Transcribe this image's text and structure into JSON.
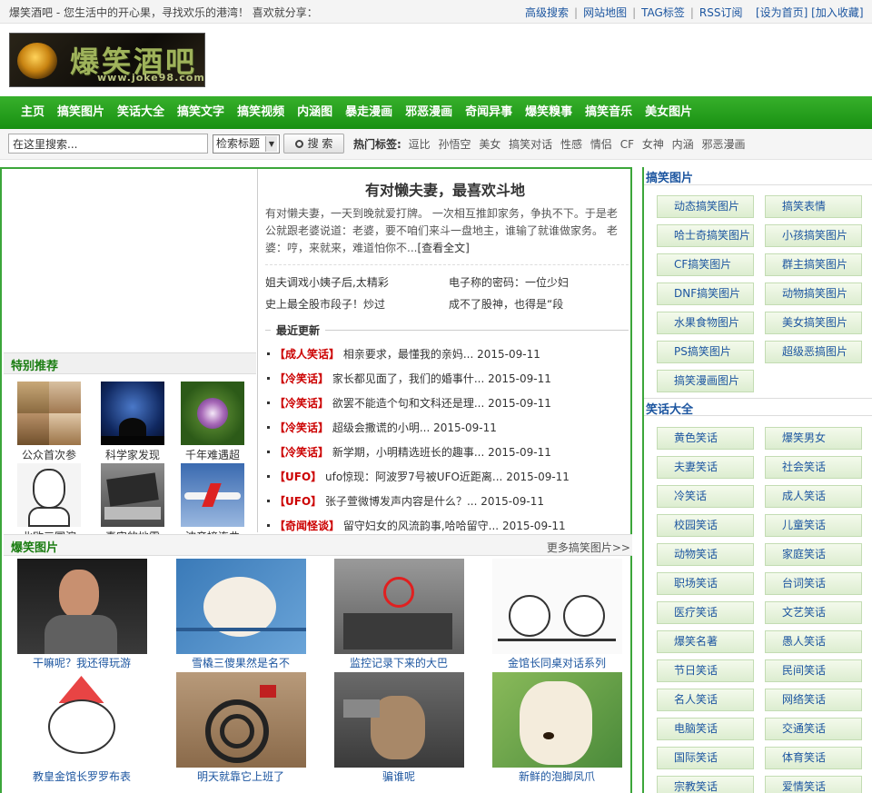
{
  "topbar": {
    "tagline": "爆笑酒吧 - 您生活中的开心果，寻找欢乐的港湾！   喜欢就分享：",
    "links": [
      "高级搜索",
      "网站地图",
      "TAG标签",
      "RSS订阅"
    ],
    "home_fav": "[设为首页] [加入收藏]"
  },
  "logo": {
    "big": "爆笑酒吧",
    "url": "www.joke98.com"
  },
  "nav": [
    "主页",
    "搞笑图片",
    "笑话大全",
    "搞笑文字",
    "搞笑视频",
    "内涵图",
    "暴走漫画",
    "邪恶漫画",
    "奇闻异事",
    "爆笑糗事",
    "搞笑音乐",
    "美女图片"
  ],
  "search": {
    "value": "在这里搜索...",
    "select_label": "检索标题",
    "button": "搜 索",
    "hot_label": "热门标签:",
    "hot_tags": [
      "逗比",
      "孙悟空",
      "美女",
      "搞笑对话",
      "性感",
      "情侣",
      "CF",
      "女神",
      "内涵",
      "邪恶漫画"
    ]
  },
  "tebie": {
    "title": "特别推荐",
    "items": [
      {
        "caption": "公众首次参"
      },
      {
        "caption": "科学家发现"
      },
      {
        "caption": "千年难遇超"
      },
      {
        "caption": "北欧三国演"
      },
      {
        "caption": "真实的地震"
      },
      {
        "caption": "波音接连曲"
      }
    ]
  },
  "feature": {
    "title": "有对懒夫妻，最喜欢斗地",
    "summary": "有对懒夫妻，一天到晚就爱打牌。 一次相互推卸家务，争执不下。于是老公就跟老婆说道：老婆，要不咱们来斗一盘地主，谁输了就谁做家务。 老婆：哼，来就来，难道怕你不...",
    "more": "[查看全文]",
    "links": [
      "姐夫调戏小姨子后,太精彩",
      "电子称的密码：一位少妇",
      "史上最全股市段子！炒过",
      "成不了股神，也得是“段"
    ]
  },
  "recent": {
    "title": "最近更新",
    "items": [
      {
        "cat": "【成人笑话】",
        "text": "相亲要求，最懂我的亲妈...",
        "date": "2015-09-11"
      },
      {
        "cat": "【冷笑话】",
        "text": "家长都见面了，我们的婚事什...",
        "date": "2015-09-11"
      },
      {
        "cat": "【冷笑话】",
        "text": "欲罢不能造个句和文科还是理...",
        "date": "2015-09-11"
      },
      {
        "cat": "【冷笑话】",
        "text": "超级会撒谎的小明...",
        "date": "2015-09-11"
      },
      {
        "cat": "【冷笑话】",
        "text": "新学期，小明精选班长的趣事...",
        "date": "2015-09-11"
      },
      {
        "cat": "【UFO】",
        "text": "ufo惊现：阿波罗7号被UFO近距离...",
        "date": "2015-09-11"
      },
      {
        "cat": "【UFO】",
        "text": "张子萱微博发声内容是什么？...",
        "date": "2015-09-11"
      },
      {
        "cat": "【奇闻怪谈】",
        "text": "留守妇女的风流韵事,哈哈留守...",
        "date": "2015-09-11"
      }
    ]
  },
  "gifs": {
    "title": "爆笑图片",
    "more": "更多搞笑图片>>",
    "items": [
      {
        "caption": "干嘛呢？我还得玩游"
      },
      {
        "caption": "雪橇三傻果然是名不"
      },
      {
        "caption": "监控记录下来的大巴"
      },
      {
        "caption": "金馆长同桌对话系列"
      },
      {
        "caption": "教皇金馆长罗罗布表"
      },
      {
        "caption": "明天就靠它上班了"
      },
      {
        "caption": "骗谁呢"
      },
      {
        "caption": "新鲜的泡脚凤爪"
      }
    ]
  },
  "side": {
    "sec1": {
      "title": "搞笑图片",
      "items": [
        "动态搞笑图片",
        "搞笑表情",
        "哈士奇搞笑图片",
        "小孩搞笑图片",
        "CF搞笑图片",
        "群主搞笑图片",
        "DNF搞笑图片",
        "动物搞笑图片",
        "水果食物图片",
        "美女搞笑图片",
        "PS搞笑图片",
        "超级恶搞图片",
        "搞笑漫画图片"
      ]
    },
    "sec2": {
      "title": "笑话大全",
      "items": [
        "黄色笑话",
        "爆笑男女",
        "夫妻笑话",
        "社会笑话",
        "冷笑话",
        "成人笑话",
        "校园笑话",
        "儿童笑话",
        "动物笑话",
        "家庭笑话",
        "职场笑话",
        "台词笑话",
        "医疗笑话",
        "文艺笑话",
        "爆笑名著",
        "愚人笑话",
        "节日笑话",
        "民间笑话",
        "名人笑话",
        "网络笑话",
        "电脑笑话",
        "交通笑话",
        "国际笑话",
        "体育笑话",
        "宗教笑话",
        "爱情笑话"
      ]
    }
  }
}
